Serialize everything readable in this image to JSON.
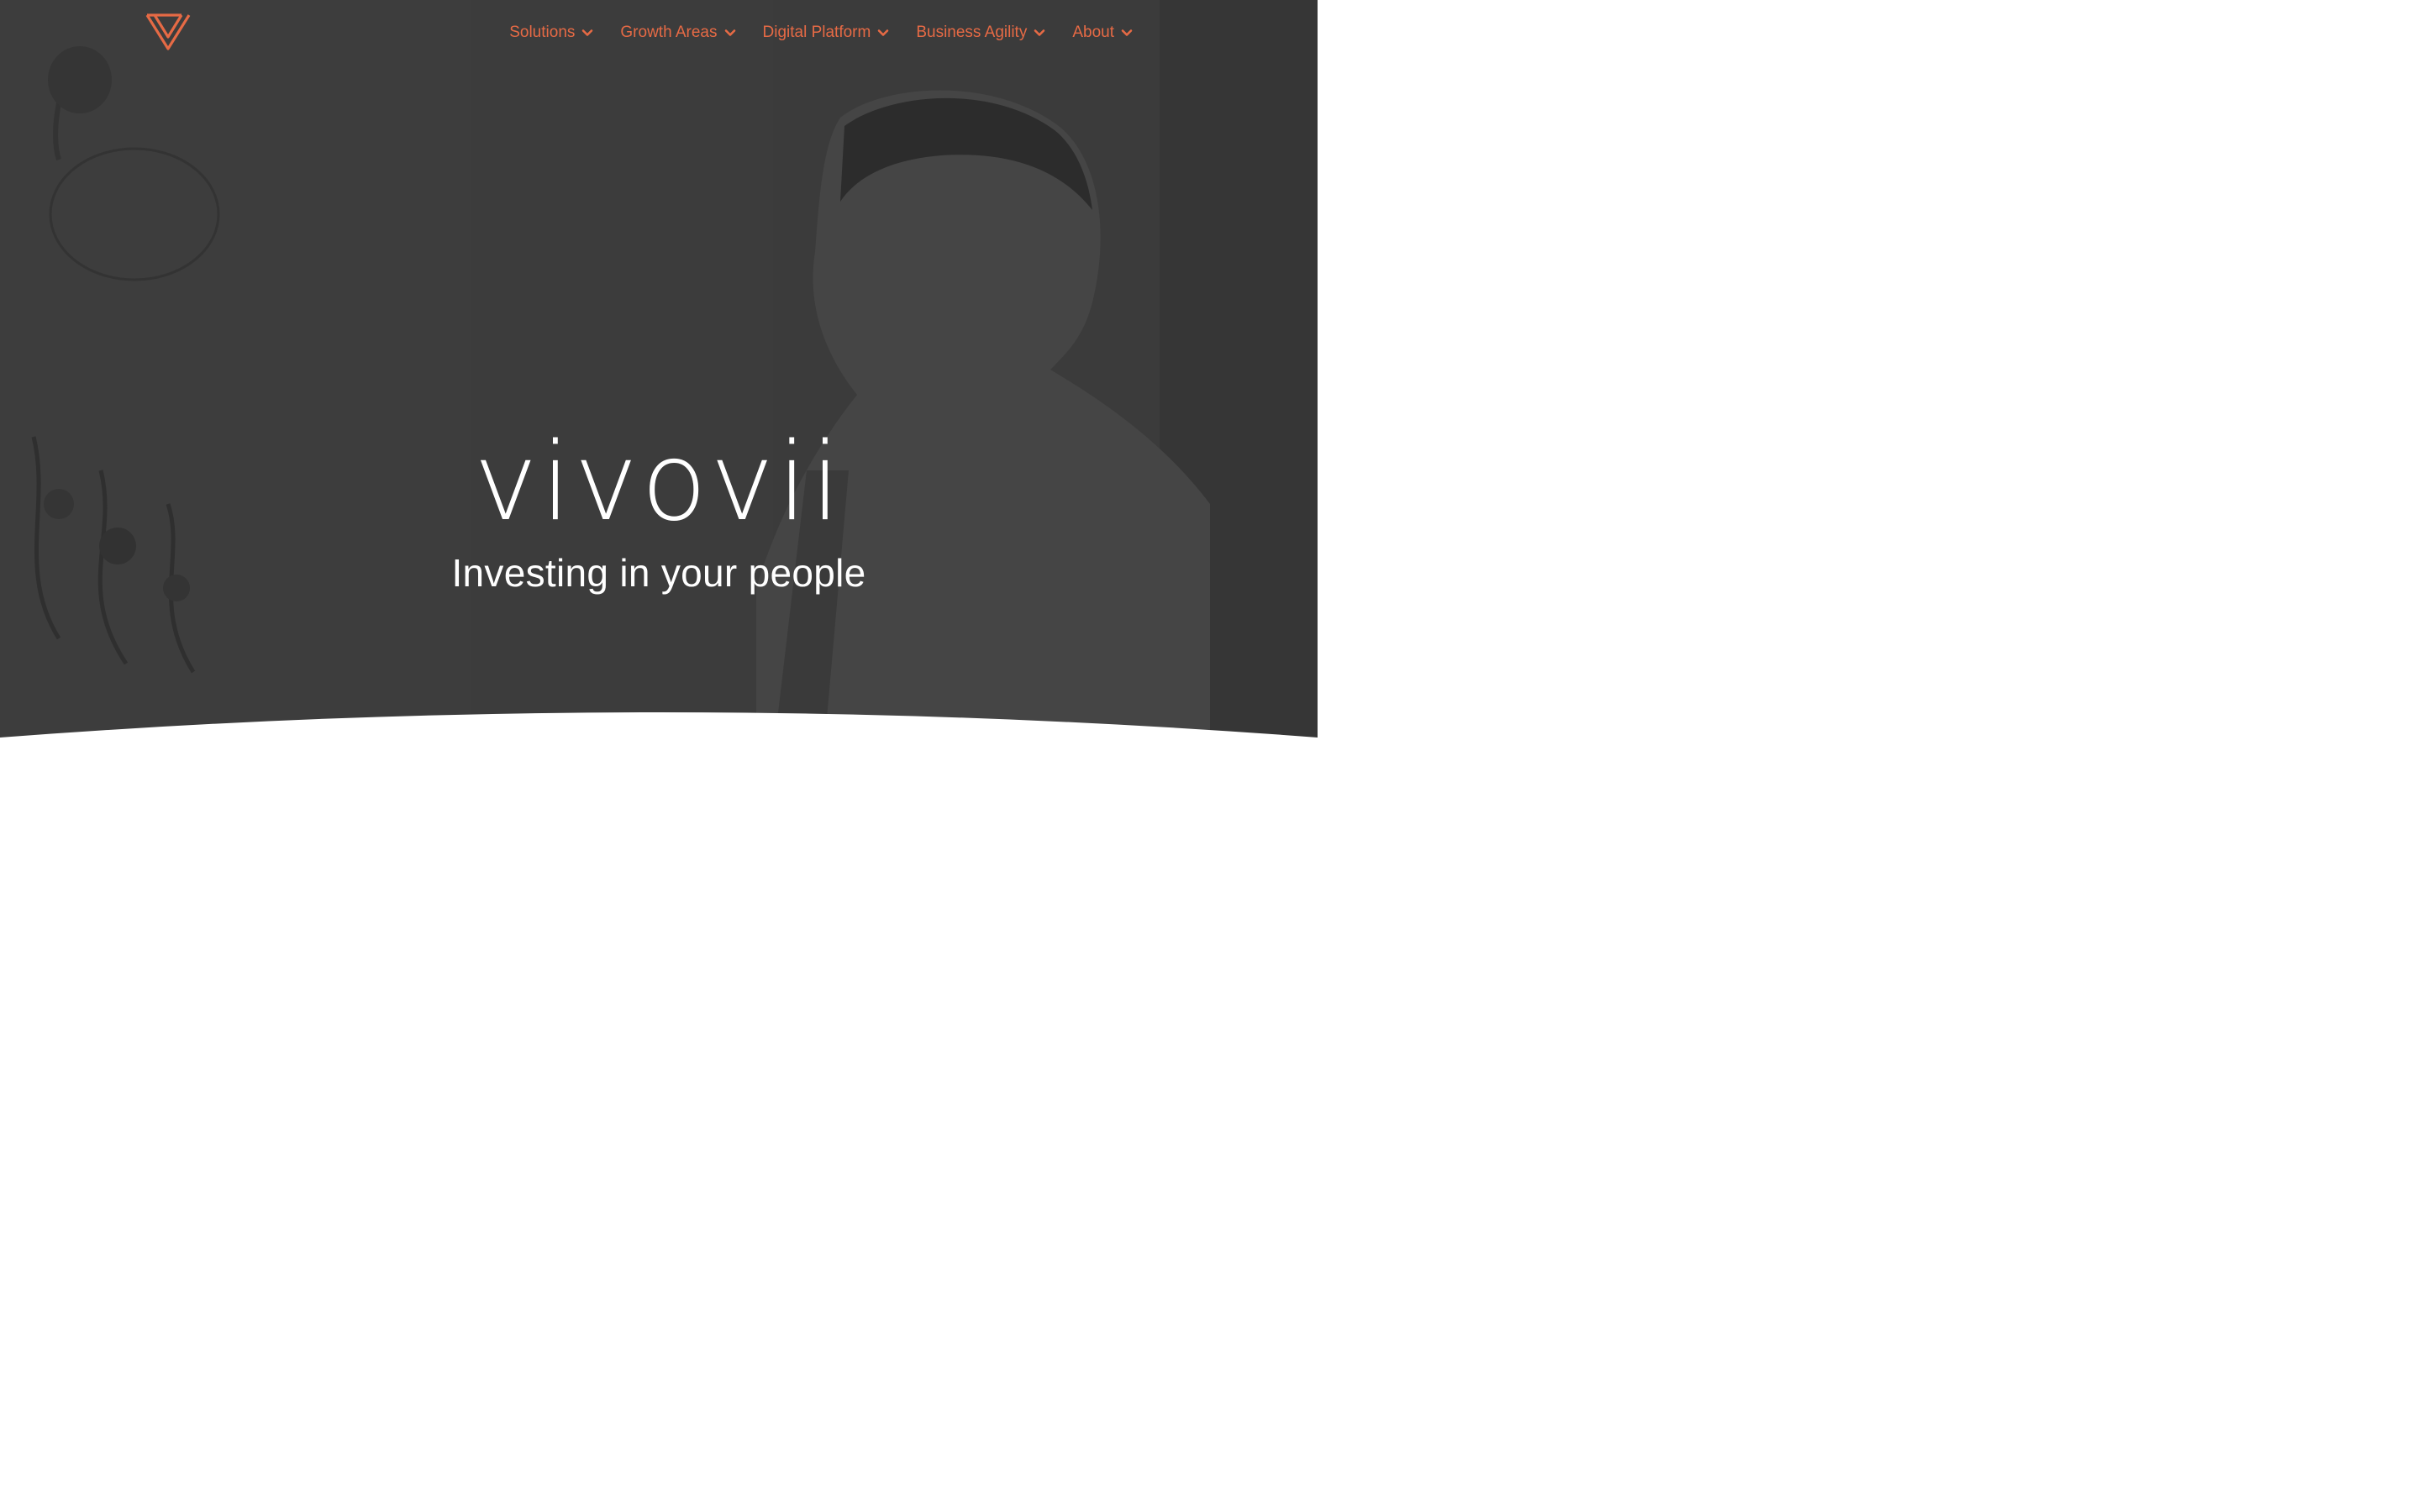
{
  "brand": {
    "logo_icon": "v-logo-icon",
    "wordmark": "vivovii",
    "tagline": "Investing in your people",
    "accent_color": "#e66a45"
  },
  "nav": {
    "items": [
      {
        "label": "Solutions",
        "icon": "chevron-down-icon"
      },
      {
        "label": "Growth Areas",
        "icon": "chevron-down-icon"
      },
      {
        "label": "Digital Platform",
        "icon": "chevron-down-icon"
      },
      {
        "label": "Business Agility",
        "icon": "chevron-down-icon"
      },
      {
        "label": "About",
        "icon": "chevron-down-icon"
      }
    ]
  },
  "hero": {
    "overlay_color": "#3d3d3d",
    "background_image": "dimmed-photo-person-looking-right"
  }
}
